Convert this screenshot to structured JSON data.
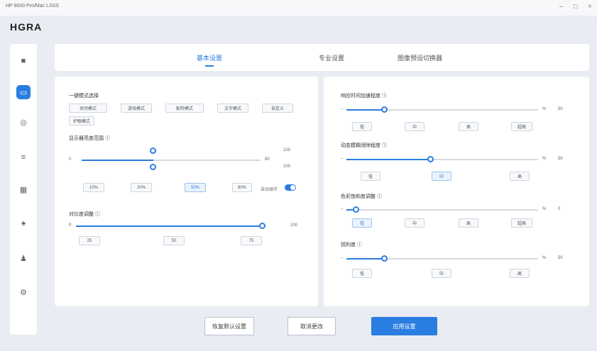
{
  "window": {
    "title": "HP 9000 Pro/Mac LSSS",
    "brand": "HGRA",
    "controls": [
      "–",
      "□",
      "×"
    ]
  },
  "sidebar": {
    "items": [
      {
        "icon": "home-icon",
        "glyph": "■"
      },
      {
        "icon": "display-icon",
        "glyph": "▭",
        "active": true
      },
      {
        "icon": "color-icon",
        "glyph": "◎"
      },
      {
        "icon": "sliders-icon",
        "glyph": "≡"
      },
      {
        "icon": "grid-icon",
        "glyph": "▦"
      },
      {
        "icon": "game-icon",
        "glyph": "♠"
      },
      {
        "icon": "user-icon",
        "glyph": "♟"
      },
      {
        "icon": "settings-icon",
        "glyph": "⚙"
      }
    ]
  },
  "tabs": [
    {
      "label": "基本设置",
      "active": true
    },
    {
      "label": "专业设置",
      "active": false
    },
    {
      "label": "图像预设切换器",
      "active": false
    }
  ],
  "left": {
    "mode_label": "一键模式选择",
    "mode_chips": [
      "关闭模式",
      "游戏模式",
      "影院模式",
      "文字模式",
      "自定义",
      "护眼模式"
    ],
    "range_label": "显示器亮度范围 ⓘ",
    "range_min": "0",
    "range_max_top": "100",
    "range_val": "80",
    "range_max_bottom": "100",
    "range_chips": [
      "10%",
      "20%",
      "50%",
      "80%"
    ],
    "range_fraction": 0.4,
    "auto_label": "自动调节",
    "auto_on": true,
    "contrast_label": "对比度调整 ⓘ",
    "contrast_min": "0",
    "contrast_val": "100",
    "contrast_chips": [
      "25",
      "50",
      "75"
    ],
    "contrast_fraction": 0.98
  },
  "right": {
    "sliders": [
      {
        "label": "响应时间加速程度 ⓘ",
        "value": "50",
        "unit": "%",
        "fraction": 0.2,
        "chips": [
          "低",
          "中",
          "高",
          "超高"
        ]
      },
      {
        "label": "动态模糊消除程度 ⓘ",
        "value": "50",
        "unit": "%",
        "fraction": 0.44,
        "chips": [
          "低",
          "中",
          "高"
        ],
        "selected": 1
      },
      {
        "label": "色彩饱和度调整 ⓘ",
        "value": "0",
        "unit": "%",
        "fraction": 0.05,
        "chips": [
          "低",
          "中",
          "高",
          "超高"
        ],
        "selected": 0
      },
      {
        "label": "锐利度 ⓘ",
        "value": "50",
        "unit": "%",
        "fraction": 0.2,
        "chips": [
          "低",
          "中",
          "高"
        ]
      }
    ]
  },
  "footer": {
    "reset_label": "恢复默认设置",
    "cancel_label": "取消更改",
    "apply_label": "应用设置"
  },
  "colors": {
    "accent": "#2a7de1",
    "background": "#e9ecf2",
    "panel": "#ffffff"
  }
}
